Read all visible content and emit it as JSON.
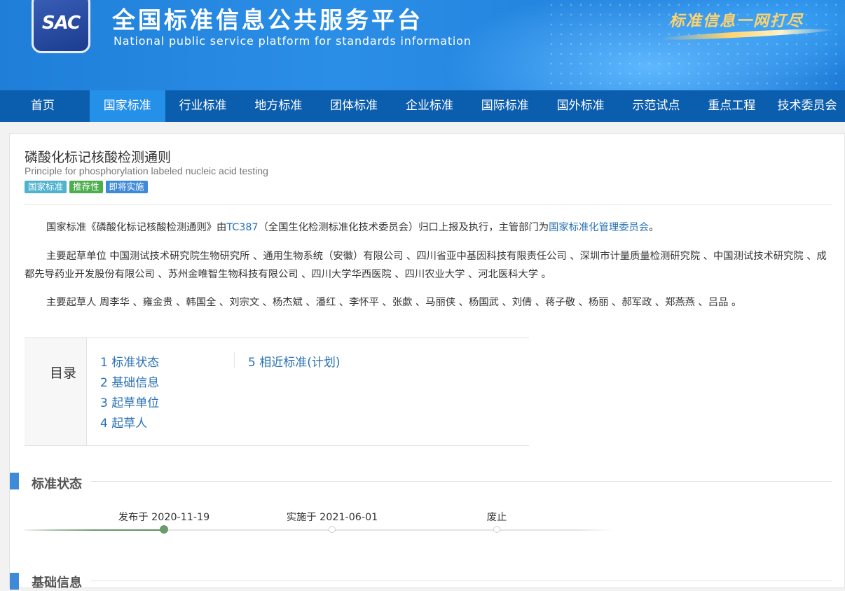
{
  "header": {
    "logo_text": "SAC",
    "site_title": "全国标准信息公共服务平台",
    "site_subtitle": "National public service platform  for standards information",
    "slogan": "标准信息一网打尽"
  },
  "nav": {
    "items": [
      "首页",
      "国家标准",
      "行业标准",
      "地方标准",
      "团体标准",
      "企业标准",
      "国际标准",
      "国外标准",
      "示范试点",
      "重点工程",
      "技术委员会"
    ],
    "active_index": 1
  },
  "standard": {
    "title_cn": "磷酸化标记核酸检测通则",
    "title_en": "Principle for phosphorylation labeled nucleic acid testing",
    "badges": [
      "国家标准",
      "推荐性",
      "即将实施"
    ],
    "intro": {
      "prefix": "国家标准《磷酸化标记核酸检测通则》由",
      "tc_link": "TC387",
      "middle": "（全国生化检测标准化技术委员会）归口上报及执行，主管部门为",
      "dept_link": "国家标准化管理委员会",
      "suffix": "。"
    },
    "drafting_units": "主要起草单位 中国测试技术研究院生物研究所 、通用生物系统（安徽）有限公司 、四川省亚中基因科技有限责任公司 、深圳市计量质量检测研究院 、中国测试技术研究院 、成都先导药业开发股份有限公司 、苏州金唯智生物科技有限公司 、四川大学华西医院 、四川农业大学 、河北医科大学 。",
    "drafters": "主要起草人 周李华 、雍金贵 、韩国全 、刘宗文 、杨杰斌 、潘红 、李怀平 、张歔 、马丽侠 、杨国武 、刘倩 、蒋子敬 、杨丽 、郝军政 、郑燕燕 、吕品 。"
  },
  "toc": {
    "label": "目录",
    "items": [
      "1  标准状态",
      "2  基础信息",
      "3  起草单位",
      "4  起草人",
      "5  相近标准(计划)"
    ]
  },
  "sections": {
    "status_title": "标准状态",
    "basic_title": "基础信息"
  },
  "timeline": {
    "steps": [
      {
        "label": "发布于 2020-11-19",
        "done": true
      },
      {
        "label": "实施于 2021-06-01",
        "done": false
      },
      {
        "label": "废止",
        "done": false
      }
    ]
  },
  "colors": {
    "nav_bg": "#0b5dae",
    "nav_active": "#2590e8",
    "link": "#2a72b5",
    "badge_national": "#4fb2cf",
    "badge_recommended": "#4cae4c",
    "badge_upcoming": "#3f8ad8",
    "timeline_done": "#6b9a6b"
  }
}
